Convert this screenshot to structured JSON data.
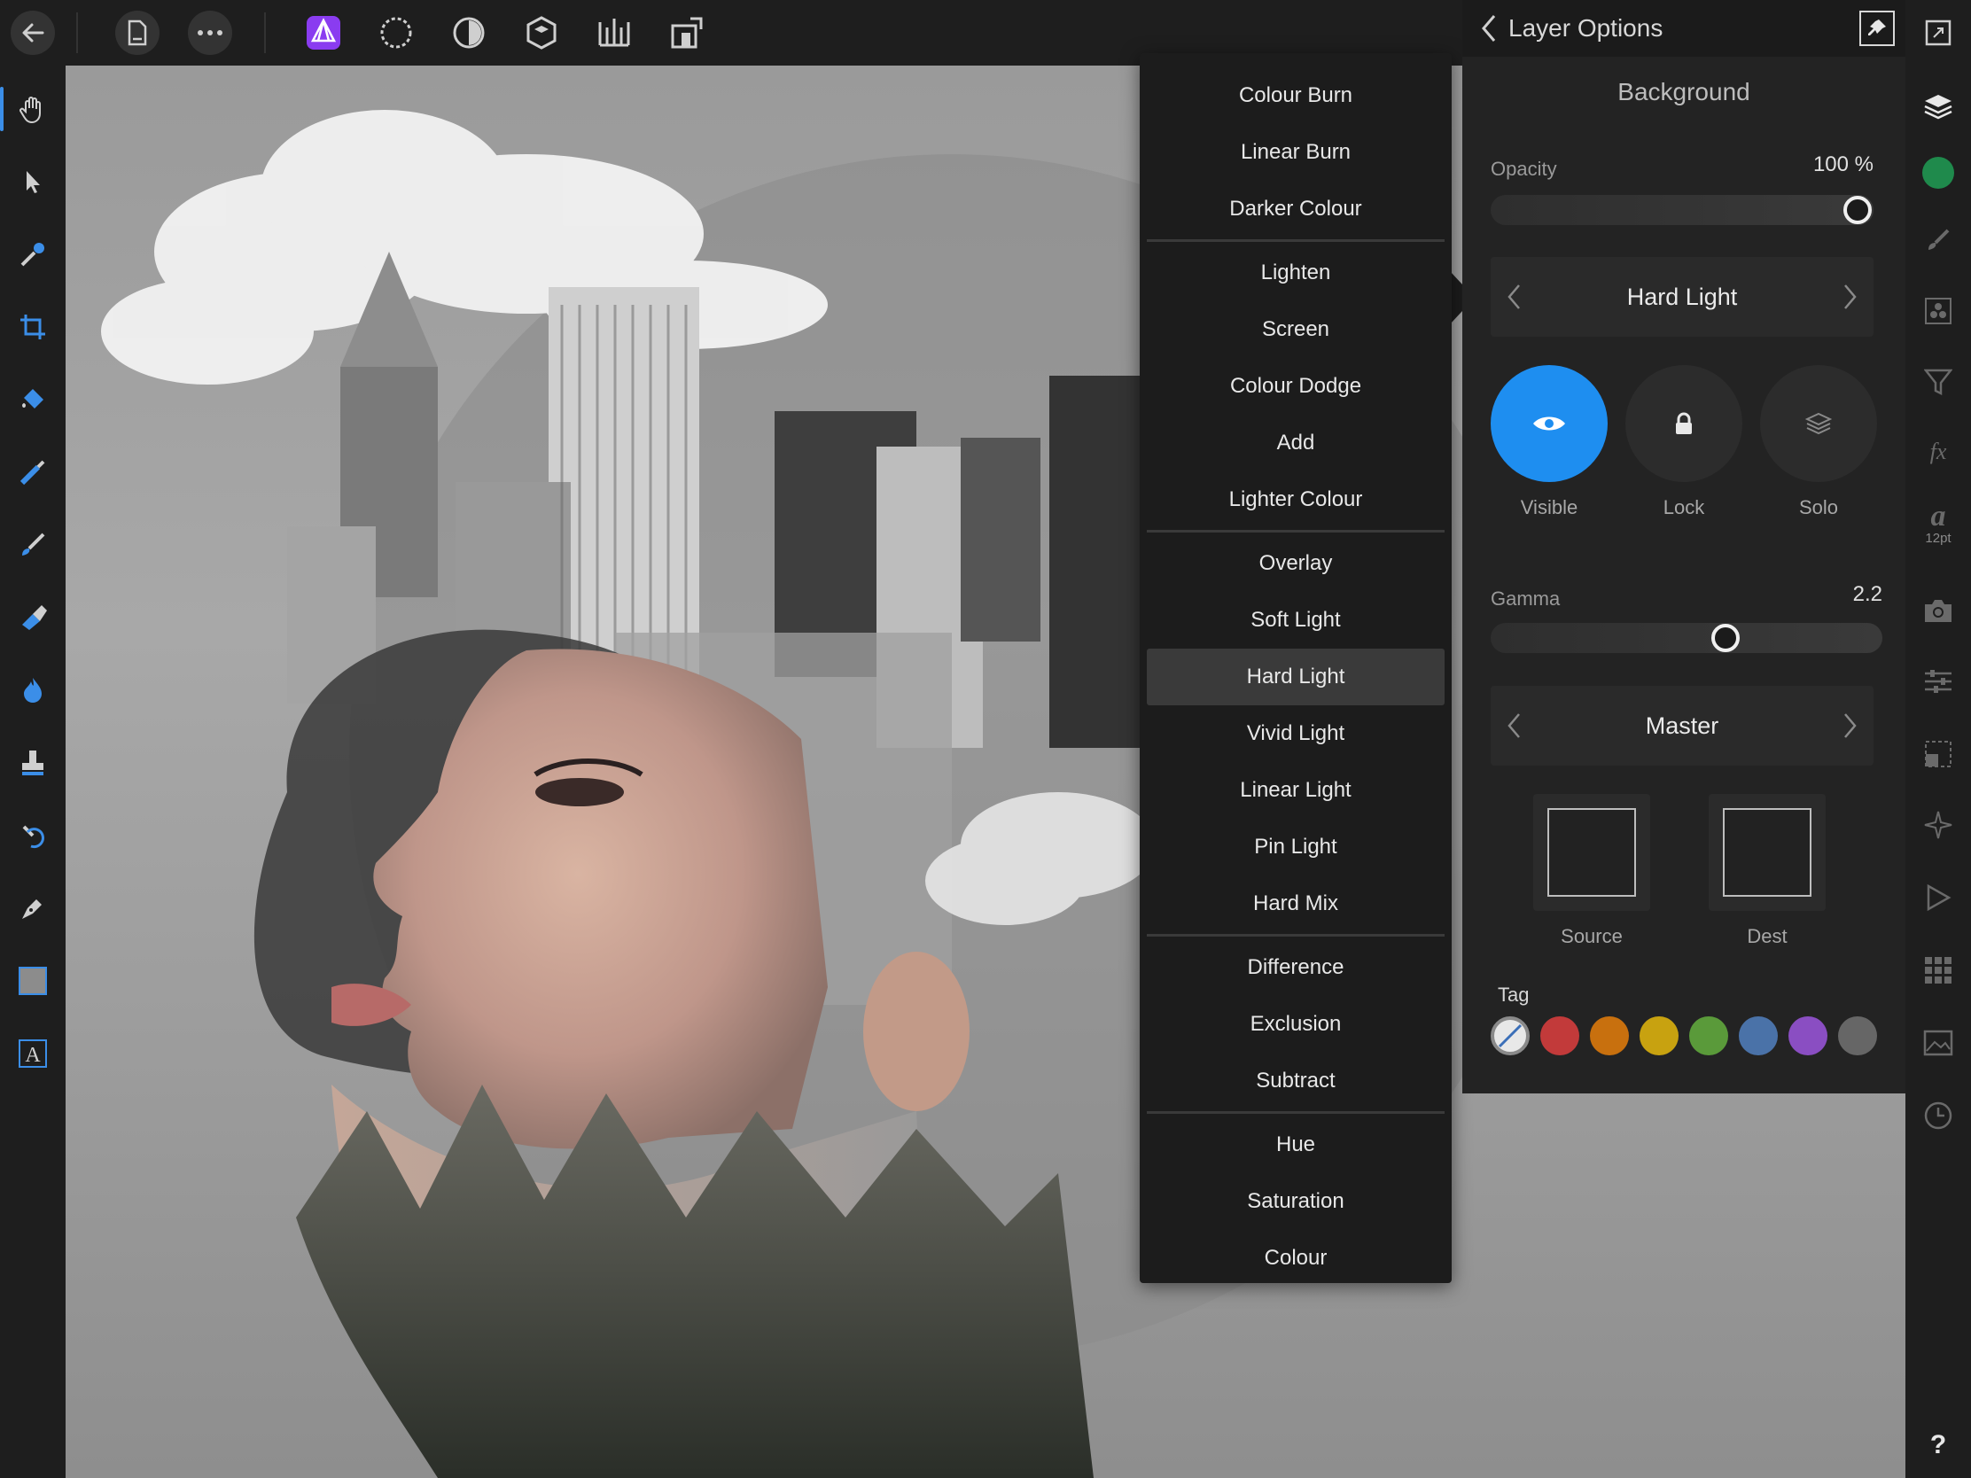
{
  "panel": {
    "title": "Layer Options",
    "layer_name": "Background",
    "opacity": {
      "label": "Opacity",
      "value_text": "100 %",
      "value": 1.0
    },
    "blend_mode": "Hard Light",
    "buttons": [
      {
        "label": "Visible",
        "icon": "eye-icon",
        "active": true
      },
      {
        "label": "Lock",
        "icon": "lock-icon",
        "active": false
      },
      {
        "label": "Solo",
        "icon": "layers-icon",
        "active": false
      }
    ],
    "gamma": {
      "label": "Gamma",
      "value_text": "2.2",
      "value": 0.61
    },
    "channel": "Master",
    "wells": [
      {
        "label": "Source"
      },
      {
        "label": "Dest"
      }
    ],
    "tag_label": "Tag",
    "tag_colors": [
      "#ffffff",
      "#c23a3a",
      "#c8700e",
      "#c8a210",
      "#5a9a3a",
      "#4a72a8",
      "#8a4ec2",
      "#666666"
    ]
  },
  "blend_menu": {
    "groups": [
      [
        "Colour Burn",
        "Linear Burn",
        "Darker Colour"
      ],
      [
        "Lighten",
        "Screen",
        "Colour Dodge",
        "Add",
        "Lighter Colour"
      ],
      [
        "Overlay",
        "Soft Light",
        "Hard Light",
        "Vivid Light",
        "Linear Light",
        "Pin Light",
        "Hard Mix"
      ],
      [
        "Difference",
        "Exclusion",
        "Subtract"
      ],
      [
        "Hue",
        "Saturation",
        "Colour"
      ]
    ],
    "selected": "Hard Light"
  },
  "right_strip": {
    "font_size_label": "12pt",
    "help_label": "?"
  },
  "colors": {
    "accent_blue": "#1e8ef0",
    "persona_purple": "#8a3cf0",
    "color_swatch_green": "#1f8a4c"
  }
}
